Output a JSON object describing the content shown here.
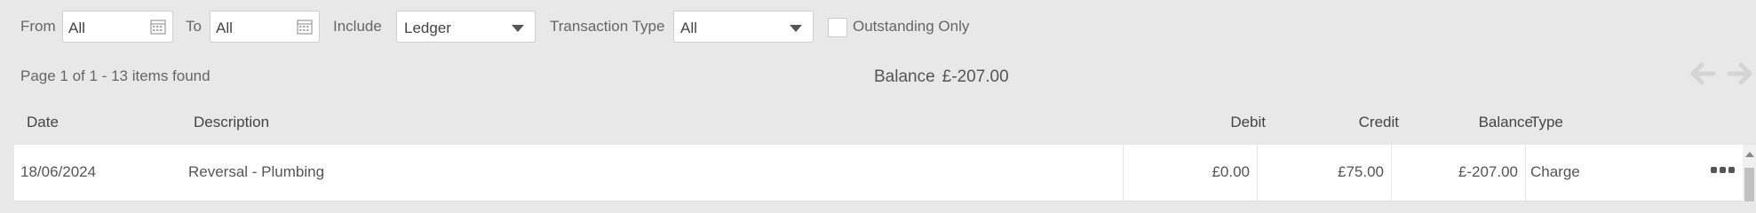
{
  "filters": {
    "from_label": "From",
    "from_value": "All",
    "to_label": "To",
    "to_value": "All",
    "include_label": "Include",
    "include_value": "Ledger",
    "transaction_type_label": "Transaction Type",
    "transaction_type_value": "All",
    "outstanding_only_label": "Outstanding Only",
    "outstanding_only_checked": false
  },
  "summary": {
    "page_info": "Page 1 of 1 - 13 items found",
    "balance_label": "Balance",
    "balance_value": "£-207.00"
  },
  "table": {
    "columns": [
      "Date",
      "Description",
      "Debit",
      "Credit",
      "Balance",
      "Type"
    ],
    "rows": [
      {
        "date": "18/06/2024",
        "description": "Reversal - Plumbing",
        "debit": "£0.00",
        "credit": "£75.00",
        "balance": "£-207.00",
        "type": "Charge"
      }
    ]
  },
  "icons": {
    "calendar": "calendar-icon",
    "dropdown": "chevron-down-icon",
    "prev": "arrow-left-icon",
    "next": "arrow-right-icon",
    "more": "more-options-icon"
  },
  "colors": {
    "background": "#e8e8e8",
    "row_background": "#ffffff",
    "arrow_disabled": "#d4d4d4"
  }
}
